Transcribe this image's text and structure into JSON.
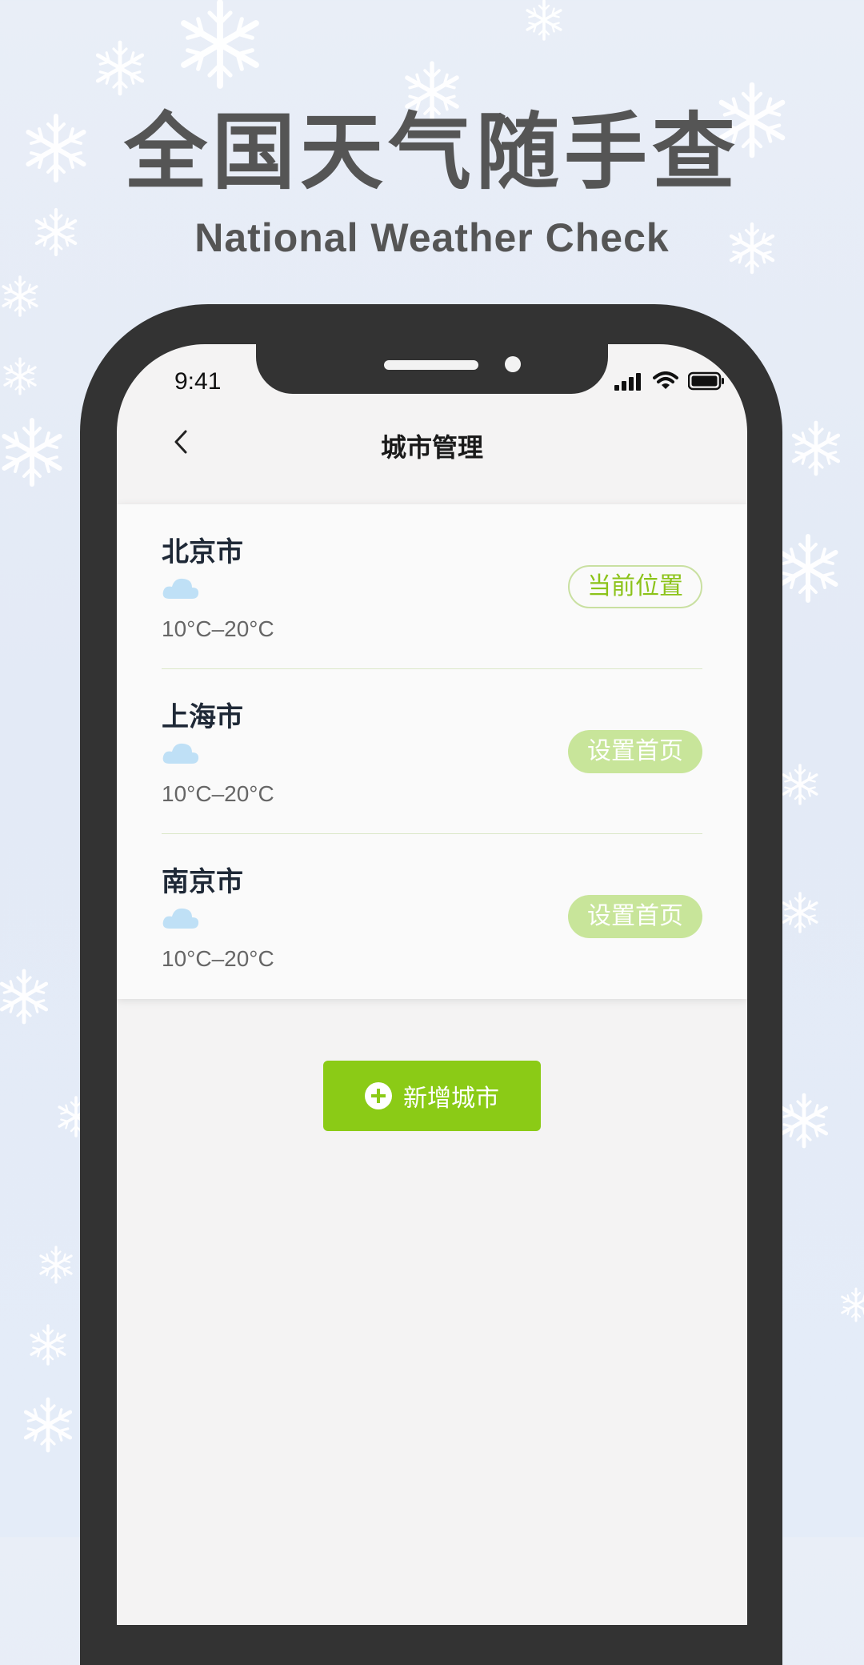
{
  "promo": {
    "headline": "全国天气随手查",
    "subheadline": "National Weather Check"
  },
  "status_bar": {
    "time": "9:41",
    "icons": [
      "signal-icon",
      "wifi-icon",
      "battery-icon"
    ]
  },
  "nav": {
    "back_icon": "chevron-left-icon",
    "title": "城市管理"
  },
  "cities": [
    {
      "name": "北京市",
      "weather_icon": "cloud-icon",
      "temp": "10°C–20°C",
      "action": "当前位置",
      "action_style": "outline"
    },
    {
      "name": "上海市",
      "weather_icon": "cloud-icon",
      "temp": "10°C–20°C",
      "action": "设置首页",
      "action_style": "filled"
    },
    {
      "name": "南京市",
      "weather_icon": "cloud-icon",
      "temp": "10°C–20°C",
      "action": "设置首页",
      "action_style": "filled"
    }
  ],
  "add_button": {
    "icon": "plus-circle-icon",
    "label": "新增城市"
  },
  "colors": {
    "accent_green": "#8bcb16",
    "light_green": "#c8e59a",
    "phone_frame": "#333333",
    "headline_gray": "#555555",
    "cloud_blue": "#bfe0f6"
  }
}
